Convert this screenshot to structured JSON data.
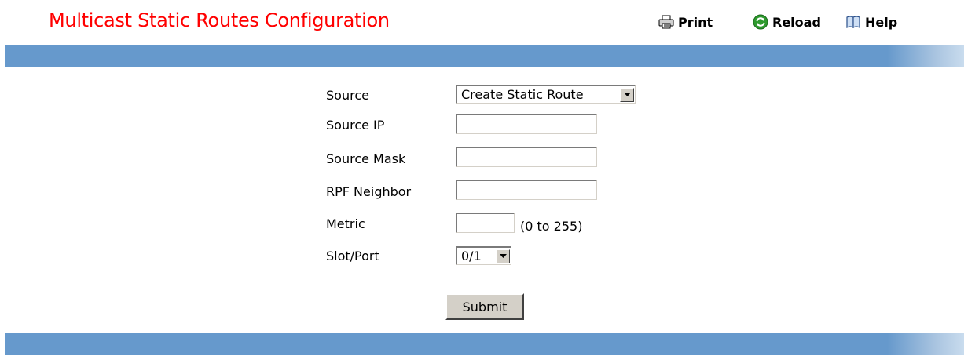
{
  "header": {
    "title": "Multicast Static Routes Configuration",
    "print_label": "Print",
    "reload_label": "Reload",
    "help_label": "Help"
  },
  "colors": {
    "title": "#ff0000",
    "bar": "#6699cc"
  },
  "icons": {
    "print": "printer-icon",
    "reload": "reload-icon",
    "help": "help-book-icon"
  },
  "form": {
    "source": {
      "label": "Source",
      "value": "Create Static Route"
    },
    "source_ip": {
      "label": "Source IP",
      "value": ""
    },
    "source_mask": {
      "label": "Source Mask",
      "value": ""
    },
    "rpf_neighbor": {
      "label": "RPF Neighbor",
      "value": ""
    },
    "metric": {
      "label": "Metric",
      "value": "",
      "hint": "(0 to 255)"
    },
    "slot_port": {
      "label": "Slot/Port",
      "value": "0/1"
    },
    "submit_label": "Submit"
  }
}
